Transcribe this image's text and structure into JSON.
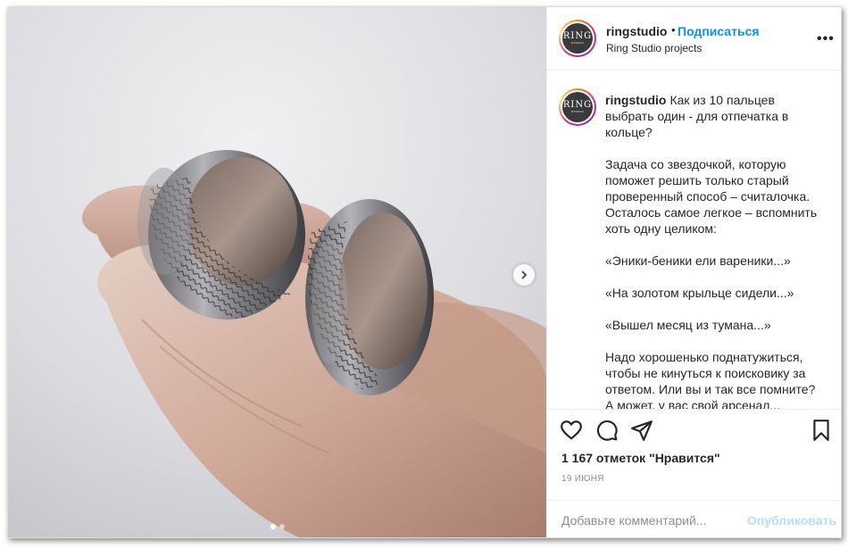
{
  "post": {
    "image_alt": "Два кольца с отпечатками пальцев",
    "carousel": {
      "total": 2,
      "current": 1
    }
  },
  "header": {
    "username": "ringstudio",
    "separator": "•",
    "follow_label": "Подписаться",
    "location": "Ring Studio projects",
    "more_label": "•••"
  },
  "avatar": {
    "logo_text": "RING",
    "sub_text": "STUDIO"
  },
  "caption": {
    "username": "ringstudio",
    "paragraphs": [
      "Как из 10 пальцев выбрать один - для отпечатка в кольце?",
      "Задача со звездочкой, которую поможет решить только старый проверенный способ – считалочка. Осталось самое легкое – вспомнить хоть одну целиком:",
      "«Эники-беники ели вареники...»",
      "«На золотом крыльце сидели...»",
      "«Вышел месяц из тумана...»",
      "Надо хорошенько поднатужиться, чтобы не кинуться к поисковику за ответом. Или вы и так все помните? А может, у вас свой арсенал..."
    ]
  },
  "actions": {
    "likes_text": "1 167 отметок \"Нравится\"",
    "date": "19 июня"
  },
  "comment": {
    "placeholder": "Добавьте комментарий...",
    "publish_label": "Опубликовать"
  }
}
